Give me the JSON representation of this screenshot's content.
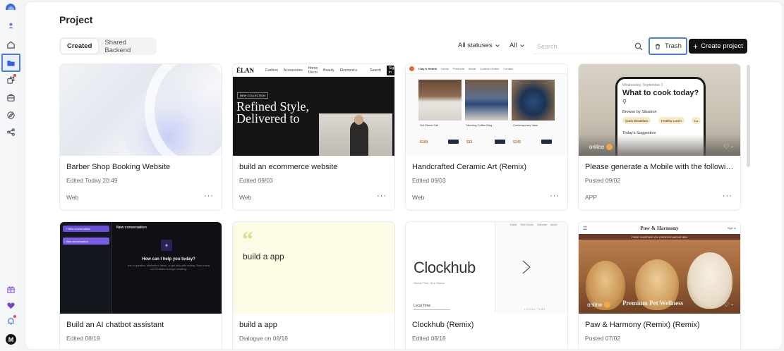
{
  "header": {
    "title": "Project",
    "tabs": [
      {
        "label": "Created",
        "active": true
      },
      {
        "label": "Shared Backend",
        "active": false
      }
    ],
    "status_filter": "All statuses",
    "type_filter": "All",
    "search_placeholder": "Search",
    "trash_label": "Trash",
    "create_label": "Create project"
  },
  "sidebar": {
    "avatar_initial": "M",
    "active_item": "projects"
  },
  "cards": [
    {
      "title": "Barber Shop Booking Website",
      "meta": "Edited Today 20:49",
      "tag": "Web",
      "more": "···"
    },
    {
      "title": "build an ecommerce website",
      "meta": "Edited 09/03",
      "tag": "Web",
      "more": "···"
    },
    {
      "title": "Handcrafted Ceramic Art (Remix)",
      "meta": "Edited 09/03",
      "tag": "Web",
      "more": "···"
    },
    {
      "title": "Please generate a Mobile with the followin...",
      "meta": "Posted 09/02",
      "tag": "APP",
      "more": "···"
    },
    {
      "title": "Build an AI chatbot assistant",
      "meta": "Edited 08/19"
    },
    {
      "title": "build a app",
      "meta": "Dialogue on 08/18"
    },
    {
      "title": "Clockhub (Remix)",
      "meta": "Edited 08/18"
    },
    {
      "title": "Paw & Harmony (Remix) (Remix)",
      "meta": "Posted 07/02"
    }
  ],
  "thumbs": {
    "elan": {
      "brand": "ÉLAN",
      "nav": [
        "Fashion",
        "Accessories",
        "Home Decor",
        "Beauty",
        "Electronics",
        "Search"
      ],
      "signin": "Sign in",
      "pill": "NEW COLLECTION",
      "headline": "Refined Style, Delivered to"
    },
    "ceramic": {
      "brand": "Clay & Hearth",
      "nav": [
        "Home",
        "Products",
        "About",
        "Custom Orders",
        "Contact"
      ],
      "items": [
        {
          "name": "Set Dinner Set",
          "price": "$189"
        },
        {
          "name": "Morning Coffee Mug",
          "price": "$32"
        },
        {
          "name": "Contemporary Vase",
          "price": "$145"
        }
      ]
    },
    "mobile": {
      "date": "Wednesday, September 2",
      "heading": "What to cook today?",
      "browse": "Browse by Situation",
      "chips": [
        "Quick Breakfast",
        "Healthy Lunch",
        "Lu"
      ],
      "suggestion": "Today's Suggestion",
      "status": "online",
      "likes": "♡ -"
    },
    "chatbot": {
      "new_conversation": "+ New conversation",
      "active_conversation": "New conversation",
      "header": "New conversation",
      "question": "How can I help you today?",
      "subtitle": "Ask a question, brainstorm ideas, or get help with writing. Start a new conversation to begin chatting."
    },
    "app": {
      "quote_mark": "“",
      "text": "build a app"
    },
    "clockhub": {
      "nav": [
        "Home",
        "Time Zones",
        "Calendar",
        "About"
      ],
      "brand": "Clockhub",
      "tagline": "Global Time, At a Glance",
      "local": "Local Time",
      "local_caps": "LOCAL TIME"
    },
    "paw": {
      "brand": "Paw & Harmony",
      "signin": "Sign in",
      "shipping": "FREE SHIPPING ON ORDERS ABOVE $50",
      "overlay": "Premium Pet Wellness",
      "status": "online",
      "likes": "♡ -"
    }
  },
  "colors": {
    "accent_outline": "#4a7fe0",
    "primary_button": "#111111",
    "notification_dot": "#e5484d"
  }
}
